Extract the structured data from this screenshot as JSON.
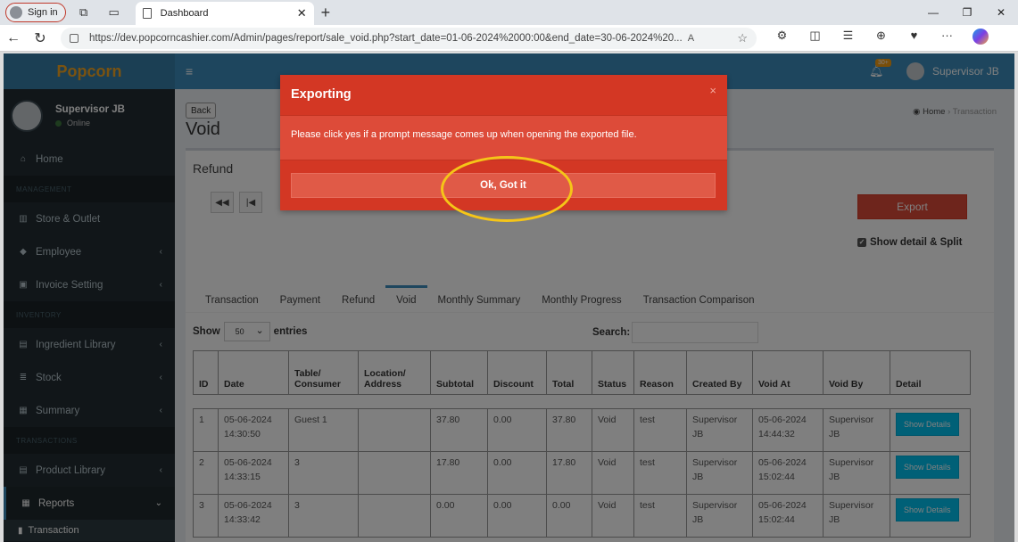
{
  "browser": {
    "signin_label": "Sign in",
    "tab_title": "Dashboard",
    "url": "https://dev.popcorncashier.com/Admin/pages/report/sale_void.php?start_date=01-06-2024%2000:00&end_date=30-06-2024%20..."
  },
  "app": {
    "logo": "Popcorn",
    "user_name": "Supervisor JB",
    "user_status": "Online",
    "notification_count": "30+",
    "top_user_name": "Supervisor JB"
  },
  "sidebar": {
    "items": [
      {
        "label": "Home"
      },
      {
        "header": "MANAGEMENT"
      },
      {
        "label": "Store & Outlet"
      },
      {
        "label": "Employee"
      },
      {
        "label": "Invoice Setting"
      },
      {
        "header": "INVENTORY"
      },
      {
        "label": "Ingredient Library"
      },
      {
        "label": "Stock"
      },
      {
        "label": "Summary"
      },
      {
        "header": "TRANSACTIONS"
      },
      {
        "label": "Product Library"
      },
      {
        "label": "Reports"
      }
    ],
    "submenu_transaction": "Transaction"
  },
  "page": {
    "back_label": "Back",
    "title": "Void",
    "breadcrumb_home": "Home",
    "breadcrumb_current": "Transaction",
    "box_title": "Refund",
    "export_label": "Export",
    "show_detail_label": "Show detail & Split",
    "tabs": [
      "Transaction",
      "Payment",
      "Refund",
      "Void",
      "Monthly Summary",
      "Monthly Progress",
      "Transaction Comparison"
    ],
    "show_label": "Show",
    "entries_value": "50",
    "entries_label": "entries",
    "search_label": "Search:"
  },
  "table": {
    "headers": [
      "ID",
      "Date",
      "Table/ Consumer",
      "Location/ Address",
      "Subtotal",
      "Discount",
      "Total",
      "Status",
      "Reason",
      "Created By",
      "Void At",
      "Void By",
      "Detail"
    ],
    "rows": [
      {
        "id": "1",
        "date": "05-06-2024 14:30:50",
        "consumer": "Guest 1",
        "location": "",
        "subtotal": "37.80",
        "discount": "0.00",
        "total": "37.80",
        "status": "Void",
        "reason": "test",
        "created_by": "Supervisor JB",
        "void_at": "05-06-2024 14:44:32",
        "void_by": "Supervisor JB",
        "detail": "Show Details"
      },
      {
        "id": "2",
        "date": "05-06-2024 14:33:15",
        "consumer": "3",
        "location": "",
        "subtotal": "17.80",
        "discount": "0.00",
        "total": "17.80",
        "status": "Void",
        "reason": "test",
        "created_by": "Supervisor JB",
        "void_at": "05-06-2024 15:02:44",
        "void_by": "Supervisor JB",
        "detail": "Show Details"
      },
      {
        "id": "3",
        "date": "05-06-2024 14:33:42",
        "consumer": "3",
        "location": "",
        "subtotal": "0.00",
        "discount": "0.00",
        "total": "0.00",
        "status": "Void",
        "reason": "test",
        "created_by": "Supervisor JB",
        "void_at": "05-06-2024 15:02:44",
        "void_by": "Supervisor JB",
        "detail": "Show Details"
      }
    ]
  },
  "modal": {
    "title": "Exporting",
    "close": "×",
    "message": "Please click yes if a prompt message comes up when opening the exported file.",
    "ok_label": "Ok, Got it"
  }
}
